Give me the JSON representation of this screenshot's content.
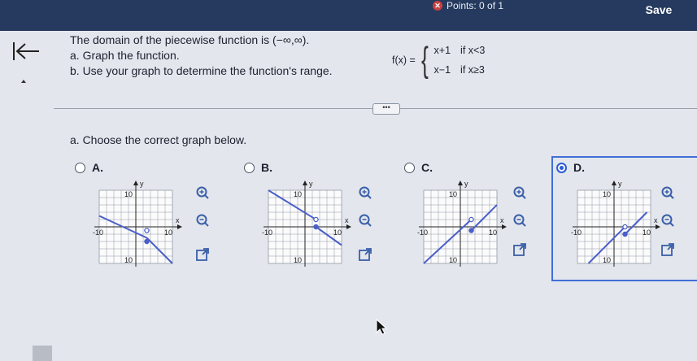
{
  "header": {
    "points_label": "Points: 0 of 1",
    "status_icon": "x-circle-icon",
    "save_label": "Save"
  },
  "question": {
    "intro": "The domain of the piecewise function is (−∞,∞).",
    "part_a": "a. Graph the function.",
    "part_b": "b. Use your graph to determine the function's range."
  },
  "function": {
    "name": "f(x) =",
    "cases": [
      {
        "expr": "x+1",
        "cond": "if  x<3"
      },
      {
        "expr": "x−1",
        "cond": "if  x≥3"
      }
    ]
  },
  "more_button": "•••",
  "sub_question": "a. Choose the correct graph below.",
  "options": [
    {
      "letter": "A.",
      "selected": false
    },
    {
      "letter": "B.",
      "selected": false
    },
    {
      "letter": "C.",
      "selected": false
    },
    {
      "letter": "D.",
      "selected": true
    }
  ],
  "graph_labels": {
    "y": "y",
    "x": "x",
    "ytop": "10",
    "ybottom": "10",
    "xleft": "-10",
    "xright": "10"
  },
  "colors": {
    "header": "#253a5e",
    "accent": "#3f6fd8",
    "line": "#4a5fc9"
  }
}
